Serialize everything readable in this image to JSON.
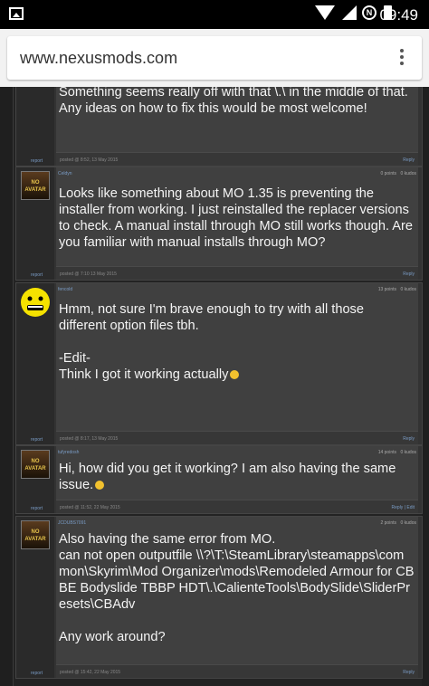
{
  "statusbar": {
    "time": "09:49"
  },
  "browser": {
    "url": "www.nexusmods.com",
    "menu_icon": "overflow-menu-icon"
  },
  "posts": [
    {
      "user": "",
      "points": "",
      "kudos": "",
      "text": "Something seems really off with that \\.\\ in the middle of that. Any ideas on how to fix this would be most welcome!",
      "date": "posted @ 8:52, 13 May 2015",
      "report": "report",
      "reply": "Reply"
    },
    {
      "user": "Celdyn",
      "points": "0 points",
      "kudos": "0 kudos",
      "text": "Looks like something about MO 1.35 is preventing the installer from working. I just reinstalled the replacer versions to check. A manual install through MO still works though. Are you familiar with manual installs through MO?",
      "date": "posted @ 7:10 13 May 2015",
      "report": "report",
      "reply": "Reply"
    },
    {
      "user": "fencold",
      "points": "13 points",
      "kudos": "0 kudos",
      "text": "Hmm, not sure I'm brave enough to try with all those different option files tbh.\n\n-Edit-\nThink I got it working actually",
      "date": "posted @ 8:17, 13 May 2015",
      "report": "report",
      "reply": "Reply"
    },
    {
      "user": "tufyredosh",
      "points": "14 points",
      "kudos": "0 kudos",
      "text": "Hi, how did you get it working? I am also having the same issue.",
      "date": "posted @ 11:52, 22 May 2015",
      "report": "report",
      "reply": "Reply | Edit"
    },
    {
      "user": "JCDUBS7091",
      "points": "2 points",
      "kudos": "0 kudos",
      "text": "Also having the same error from MO.\ncan not open outputfile \\\\?\\T:\\SteamLibrary\\steamapps\\common\\Skyrim\\Mod Organizer\\mods\\Remodeled Armour for CBBE Bodyslide TBBP HDT\\.\\CalienteTools\\BodySlide\\SliderPresets\\CBAdv\n\nAny work around?",
      "date": "posted @ 15:42, 22 May 2015",
      "report": "report",
      "reply": "Reply"
    }
  ],
  "avatar_label": "NO AVATAR"
}
